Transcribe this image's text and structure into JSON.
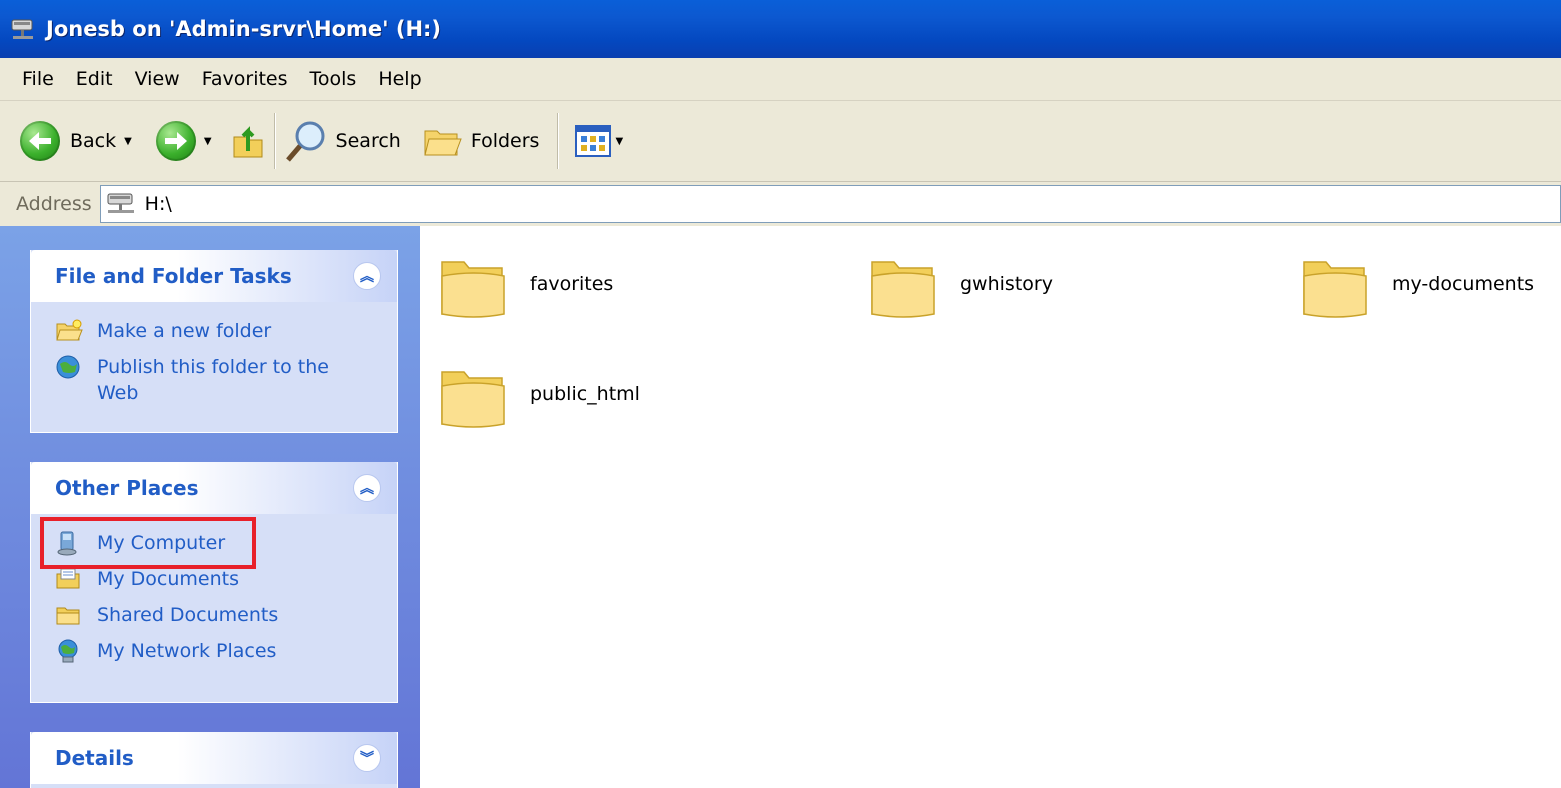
{
  "window": {
    "title": "Jonesb on 'Admin-srvr\\Home' (H:)"
  },
  "menu": [
    "File",
    "Edit",
    "View",
    "Favorites",
    "Tools",
    "Help"
  ],
  "toolbar": {
    "back_label": "Back",
    "search_label": "Search",
    "folders_label": "Folders"
  },
  "address": {
    "label": "Address",
    "value": "H:\\"
  },
  "panels": {
    "file_tasks": {
      "title": "File and Folder Tasks",
      "items": [
        "Make a new folder",
        "Publish this folder to the Web"
      ]
    },
    "other_places": {
      "title": "Other Places",
      "items": [
        "My Computer",
        "My Documents",
        "Shared Documents",
        "My Network Places"
      ]
    },
    "details": {
      "title": "Details"
    }
  },
  "folders": [
    "favorites",
    "gwhistory",
    "my-documents",
    "public_html"
  ],
  "colors": {
    "title_bar": "#0a5fd8",
    "task_link": "#215dc6",
    "highlight": "#e8202a"
  }
}
